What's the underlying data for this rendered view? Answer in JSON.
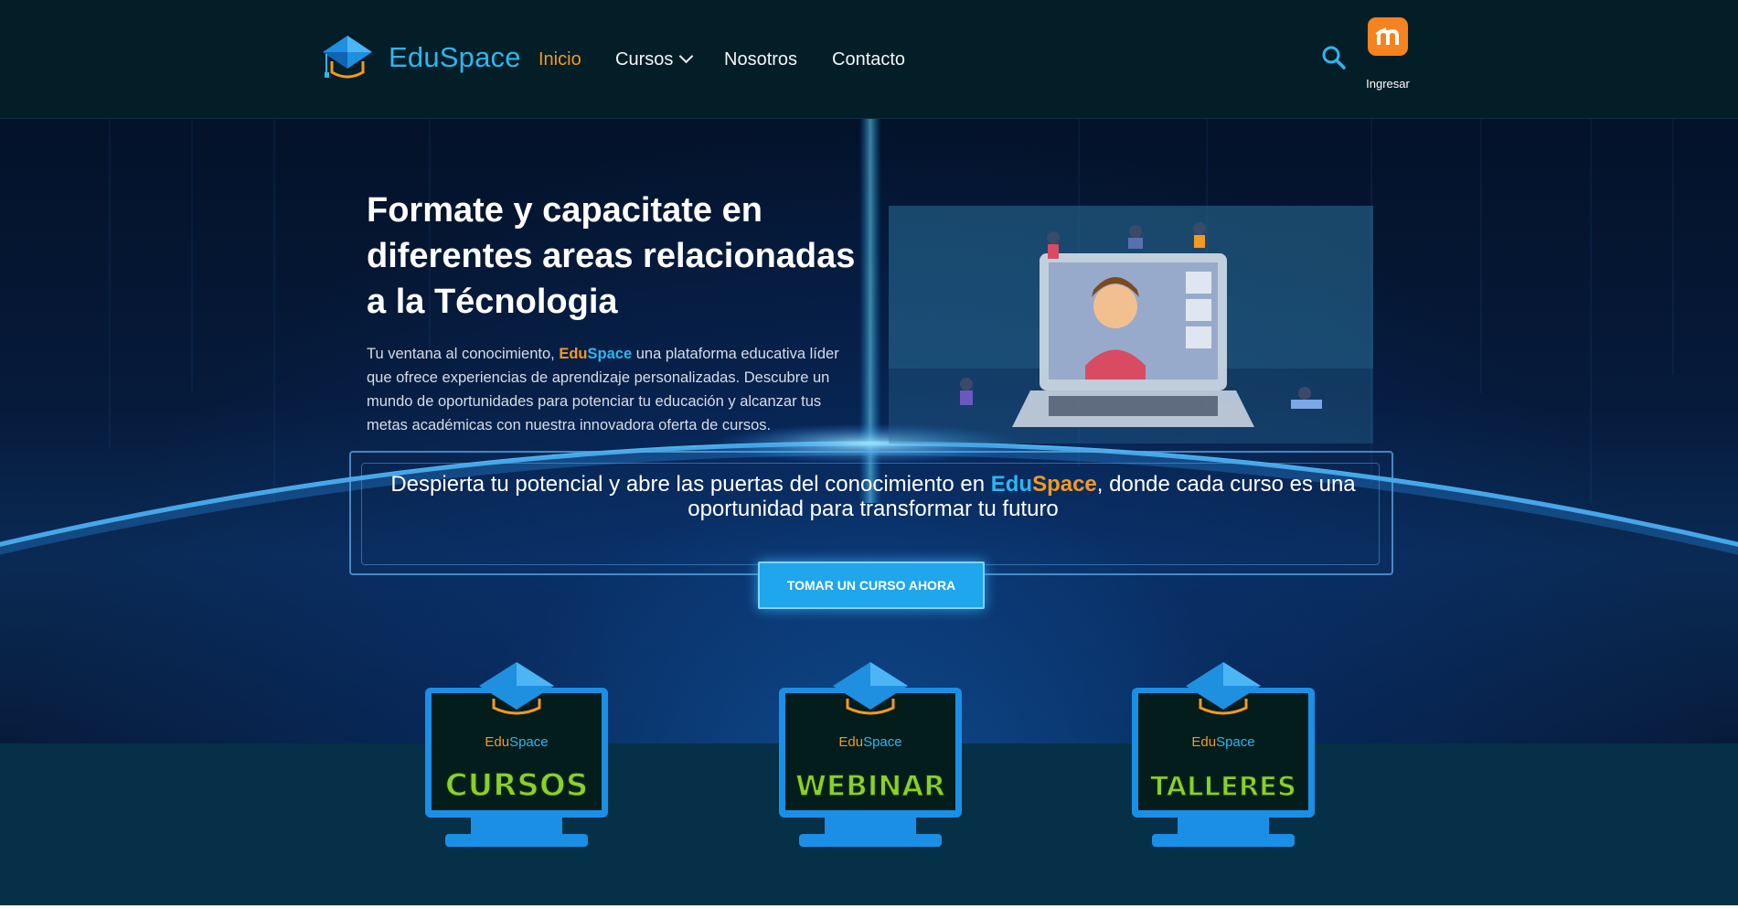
{
  "header": {
    "brand": "EduSpace",
    "nav": [
      {
        "label": "Inicio",
        "active": true
      },
      {
        "label": "Cursos",
        "active": false,
        "has_dropdown": true
      },
      {
        "label": "Nosotros",
        "active": false
      },
      {
        "label": "Contacto",
        "active": false
      }
    ],
    "search_icon": "search-icon",
    "login_icon": "moodle-icon",
    "login_label": "Ingresar"
  },
  "hero": {
    "title": "Formate y capacitate en diferentes areas relacionadas a la Técnologia",
    "description_before": "Tu ventana al conocimiento, ",
    "description_brand_a": "Edu",
    "description_brand_b": "Space",
    "description_after": " una plataforma educativa líder que ofrece experiencias de aprendizaje personalizadas. Descubre un mundo de oportunidades para potenciar tu educación y alcanzar tus metas académicas con nuestra innovadora oferta de cursos.",
    "tagline_before": "Despierta tu potencial y abre las puertas del conocimiento en ",
    "tagline_brand_a": "Edu",
    "tagline_brand_b": "Space",
    "tagline_after": ", donde cada curso es una oportunidad para transformar tu futuro",
    "cta_label": "TOMAR UN CURSO AHORA"
  },
  "cards": [
    {
      "brand_a": "Edu",
      "brand_b": "Space",
      "label": "CURSOS"
    },
    {
      "brand_a": "Edu",
      "brand_b": "Space",
      "label": "WEBINAR"
    },
    {
      "brand_a": "Edu",
      "brand_b": "Space",
      "label": "TALLERES"
    }
  ],
  "colors": {
    "brand_blue": "#2db6f0",
    "brand_orange": "#f39a1f",
    "card_label_green": "#8ccf2a",
    "header_bg": "#041e28",
    "moodle_orange": "#f5831f"
  }
}
